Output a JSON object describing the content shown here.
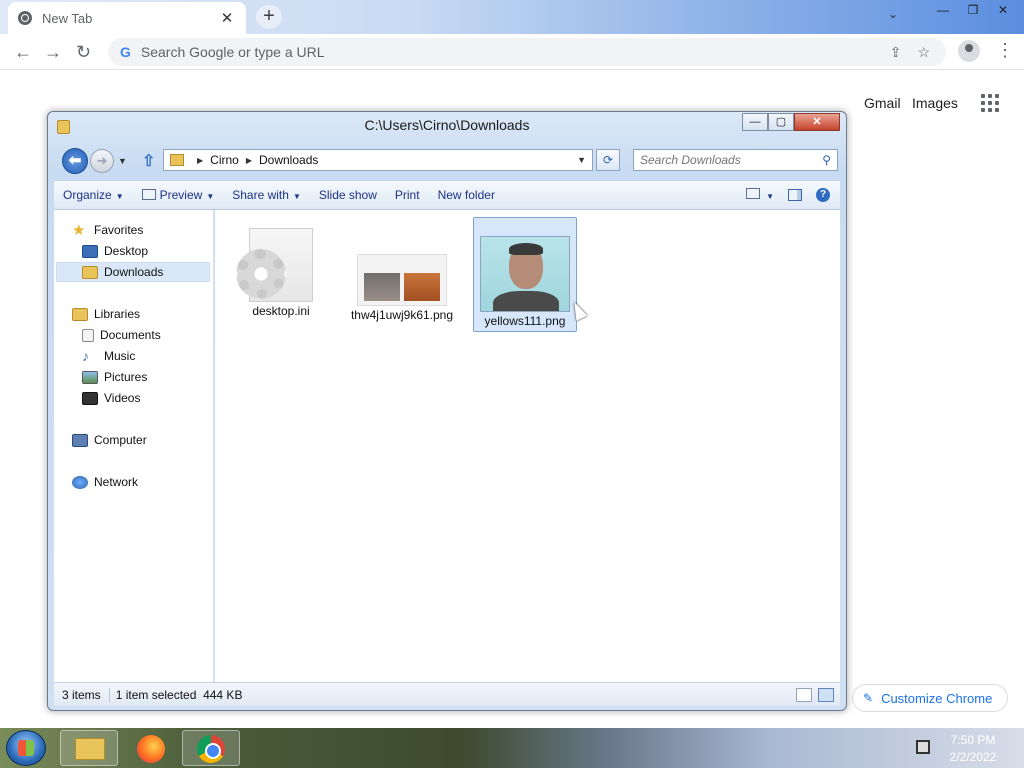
{
  "chrome": {
    "tab_title": "New Tab",
    "tab_close": "✕",
    "new_tab": "+",
    "tab_search": "⌄",
    "win_min": "—",
    "win_restore": "❐",
    "win_close": "✕",
    "back": "←",
    "forward": "→",
    "reload": "↻",
    "google_g": "G",
    "omnibox_placeholder": "Search Google or type a URL",
    "share": "⇪",
    "star": "☆",
    "menu": "⋮",
    "gmail": "Gmail",
    "images": "Images",
    "customize": "Customize Chrome",
    "pen": "✎"
  },
  "explorer": {
    "title": "C:\\Users\\Cirno\\Downloads",
    "ctrl_min": "—",
    "ctrl_max": "▢",
    "ctrl_close": "✕",
    "back": "⬅",
    "forward": "➜",
    "dropdown": "▼",
    "up": "⇧",
    "breadcrumb": [
      "Cirno",
      "Downloads"
    ],
    "breadcrumb_sep": "▶",
    "refresh": "⟳",
    "search_placeholder": "Search Downloads",
    "search_icon": "⚲",
    "toolbar": {
      "organize": "Organize",
      "preview": "Preview",
      "share_with": "Share with",
      "slide_show": "Slide show",
      "print": "Print",
      "new_folder": "New folder",
      "help": "?"
    },
    "nav": {
      "favorites": "Favorites",
      "desktop": "Desktop",
      "downloads": "Downloads",
      "libraries": "Libraries",
      "documents": "Documents",
      "music": "Music",
      "pictures": "Pictures",
      "videos": "Videos",
      "computer": "Computer",
      "network": "Network"
    },
    "files": [
      {
        "name": "desktop.ini"
      },
      {
        "name": "thw4j1uwj9k61.png"
      },
      {
        "name": "yellows111.png"
      }
    ],
    "status": {
      "items": "3 items",
      "selected": "1 item selected",
      "size": "444 KB"
    }
  },
  "taskbar": {
    "time": "7:50 PM",
    "date": "2/2/2022"
  },
  "colors": {
    "accent": "#1a73e8",
    "explorer_link": "#1e3287"
  }
}
